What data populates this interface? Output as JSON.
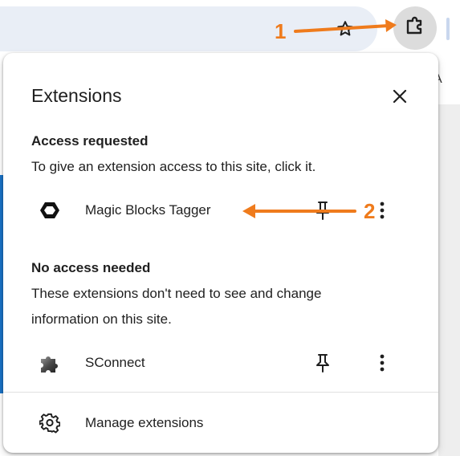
{
  "toolbar": {
    "bookmark_icon": "star-outline-icon",
    "extensions_icon": "puzzle-piece-icon",
    "background_partial_text": "A"
  },
  "popup": {
    "title": "Extensions",
    "close_icon": "close-icon",
    "access_requested": {
      "heading": "Access requested",
      "description": "To give an extension access to this site, click it.",
      "extensions": [
        {
          "name": "Magic Blocks Tagger",
          "icon": "hexagon-icon",
          "pin_icon": "pin-icon",
          "menu_icon": "more-vert-icon"
        }
      ]
    },
    "no_access_needed": {
      "heading": "No access needed",
      "description_line1": "These extensions don't need to see and change",
      "description_line2": "information on this site.",
      "extensions": [
        {
          "name": "SConnect",
          "icon": "puzzle-3d-icon",
          "pin_icon": "pin-icon",
          "menu_icon": "more-vert-icon"
        }
      ]
    },
    "manage": {
      "label": "Manage extensions",
      "icon": "gear-icon"
    }
  },
  "annotations": {
    "marker_1": "1",
    "marker_2": "2",
    "color": "#ef7b1c"
  }
}
